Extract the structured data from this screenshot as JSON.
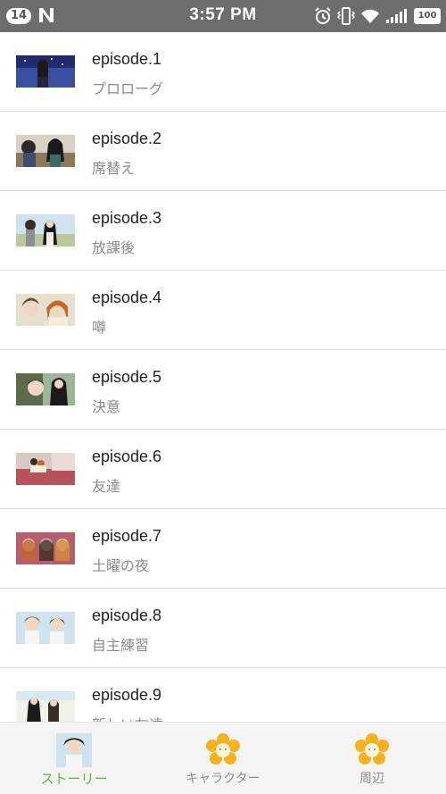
{
  "status_bar": {
    "notification_count": "14",
    "time": "3:57 PM",
    "battery": "100",
    "icons": [
      "n-logo-icon",
      "alarm-icon",
      "vibrate-icon",
      "wifi-icon",
      "signal-icon",
      "battery-icon"
    ]
  },
  "episodes": [
    {
      "title": "episode.1",
      "subtitle": "プロローグ"
    },
    {
      "title": "episode.2",
      "subtitle": "席替え"
    },
    {
      "title": "episode.3",
      "subtitle": "放課後"
    },
    {
      "title": "episode.4",
      "subtitle": "噂"
    },
    {
      "title": "episode.5",
      "subtitle": "決意"
    },
    {
      "title": "episode.6",
      "subtitle": "友達"
    },
    {
      "title": "episode.7",
      "subtitle": "土曜の夜"
    },
    {
      "title": "episode.8",
      "subtitle": "自主練習"
    },
    {
      "title": "episode.9",
      "subtitle": "新しい友達"
    }
  ],
  "tabs": [
    {
      "label": "ストーリー",
      "active": true
    },
    {
      "label": "キャラクター",
      "active": false
    },
    {
      "label": "周辺",
      "active": false
    }
  ],
  "colors": {
    "status_bar": "#6d6d6d",
    "active_tab": "#5cb82e",
    "inactive_tab": "#8a8a8a",
    "divider": "#dcdcdc"
  }
}
